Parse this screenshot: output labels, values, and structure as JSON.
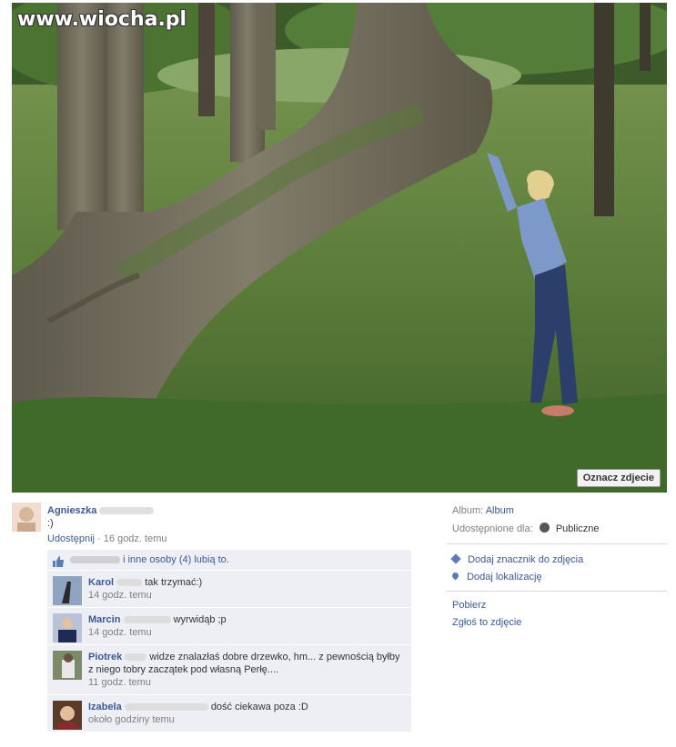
{
  "watermark": "www.wiocha.pl",
  "photo": {
    "tag_button": "Oznacz zdjecie"
  },
  "post": {
    "author": "Agnieszka",
    "text": ":)",
    "share": "Udostępnij",
    "time": "16 godz. temu",
    "likes_text": "i inne osoby (4) lubią to."
  },
  "comments": [
    {
      "name": "Karol",
      "text": "tak trzymać:)",
      "time": "14 godz. temu"
    },
    {
      "name": "Marcin",
      "text": "wyrwidąb ;p",
      "time": "14 godz. temu"
    },
    {
      "name": "Piotrek",
      "text": "widze znalazłaś dobre drzewko, hm... z pewnością byłby z niego tobry zaczątek pod własną Perłę....",
      "time": "11 godz. temu"
    },
    {
      "name": "Izabela",
      "text": "dość ciekawa poza :D",
      "time": "około godziny temu"
    }
  ],
  "sidebar": {
    "album_label": "Album:",
    "album_value": "Album",
    "shared_label": "Udostępnione dla:",
    "shared_value": "Publiczne",
    "add_tag": "Dodaj znacznik do zdjęcia",
    "add_location": "Dodaj lokalizację",
    "download": "Pobierz",
    "report": "Zgłoś to zdjęcie"
  },
  "icons": [
    "like-thumb-icon",
    "globe-icon",
    "tag-icon",
    "location-pin-icon"
  ]
}
